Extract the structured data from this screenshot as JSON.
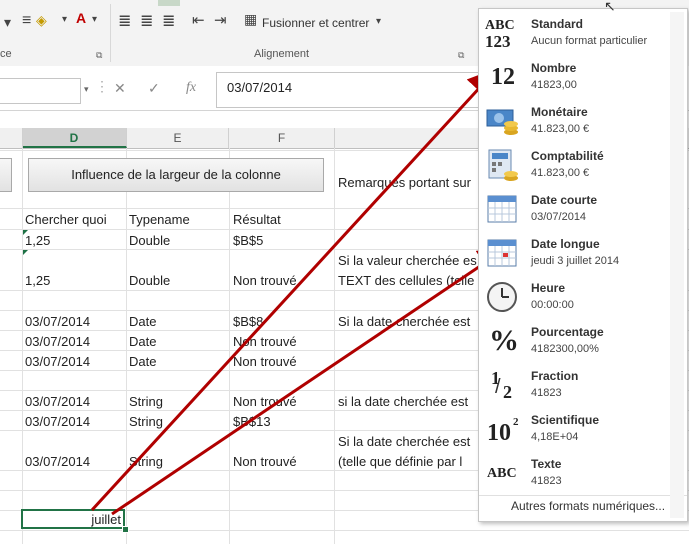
{
  "ribbon": {
    "font_label_partial": "ce",
    "alignment_label": "Alignement",
    "merge_label": "Fusionner et centrer"
  },
  "formula_bar": {
    "value": "03/07/2014"
  },
  "columns": [
    "D",
    "E",
    "F"
  ],
  "sheet": {
    "button_label": "Influence de la largeur de la colonne",
    "remarks_header": "Remarques portant sur",
    "headers": [
      "Chercher quoi",
      "Typename",
      "Résultat"
    ],
    "rows": [
      {
        "a": "1,25",
        "b": "Double",
        "c": "$B$5",
        "d": ""
      },
      {
        "a": "1,25",
        "b": "Double",
        "c": "Non trouvé",
        "d": "Si la valeur cherchée es",
        "d2": "TEXT des cellules (telle"
      },
      {
        "a": "03/07/2014",
        "b": "Date",
        "c": "$B$8",
        "d": "Si la date cherchée est"
      },
      {
        "a": "03/07/2014",
        "b": "Date",
        "c": "Non trouvé",
        "d": ""
      },
      {
        "a": "03/07/2014",
        "b": "Date",
        "c": "Non trouvé",
        "d": ""
      },
      {
        "a": "03/07/2014",
        "b": "String",
        "c": "Non trouvé",
        "d": "si la date cherchée est"
      },
      {
        "a": "03/07/2014",
        "b": "String",
        "c": "$B$13",
        "d": ""
      },
      {
        "a": "03/07/2014",
        "b": "String",
        "c": "Non trouvé",
        "d": "Si la date cherchée est",
        "d2": "(telle que définie par l"
      }
    ],
    "active_cell_value": "juillet"
  },
  "format_menu": {
    "items": [
      {
        "title": "Standard",
        "sub": "Aucun format particulier",
        "icon": "abc-123-icon"
      },
      {
        "title": "Nombre",
        "sub": "41823,00",
        "icon": "number-12-icon"
      },
      {
        "title": "Monétaire",
        "sub": "41.823,00 €",
        "icon": "currency-icon"
      },
      {
        "title": "Comptabilité",
        "sub": " 41.823,00 €",
        "icon": "accounting-icon"
      },
      {
        "title": "Date courte",
        "sub": "03/07/2014",
        "icon": "short-date-calendar-icon"
      },
      {
        "title": "Date longue",
        "sub": "jeudi 3 juillet 2014",
        "icon": "long-date-calendar-icon"
      },
      {
        "title": "Heure",
        "sub": "00:00:00",
        "icon": "clock-icon"
      },
      {
        "title": "Pourcentage",
        "sub": "4182300,00%",
        "icon": "percent-icon"
      },
      {
        "title": "Fraction",
        "sub": "41823",
        "icon": "fraction-icon"
      },
      {
        "title": "Scientifique",
        "sub": "4,18E+04",
        "icon": "scientific-icon"
      },
      {
        "title": "Texte",
        "sub": "41823",
        "icon": "text-abc-icon"
      }
    ],
    "more_formats": "Autres formats numériques..."
  },
  "icon_glyphs": {
    "abc": "ABC",
    "n123": "123",
    "n12": "12",
    "percent": "%",
    "half_1": "1",
    "half_2": "2",
    "ten": "10",
    "exp": "2",
    "fx": "fx"
  }
}
